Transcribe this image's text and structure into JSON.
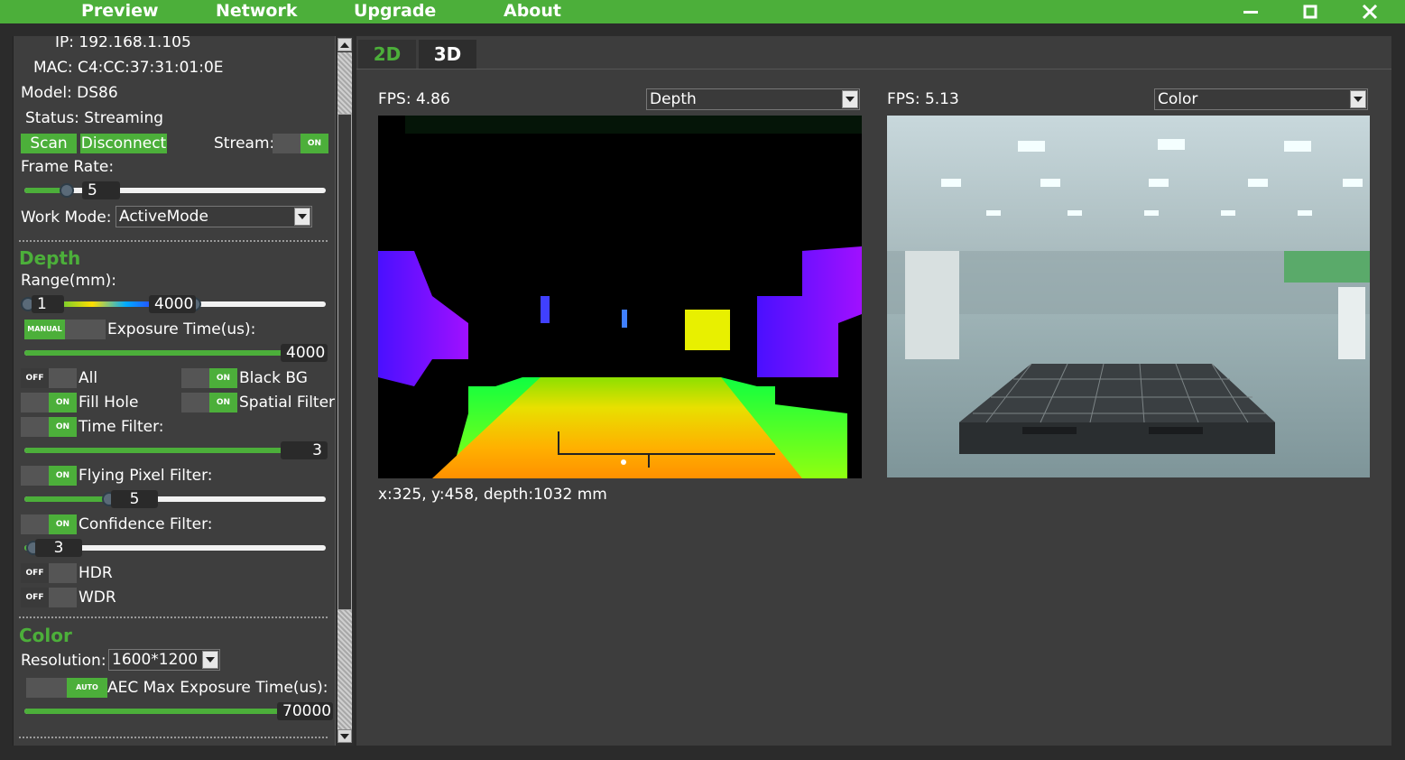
{
  "menu": {
    "preview": "Preview",
    "network": "Network",
    "upgrade": "Upgrade",
    "about": "About"
  },
  "window_controls": [
    "minimize-icon",
    "maximize-icon",
    "close-icon"
  ],
  "device": {
    "ip": "IP: 192.168.1.105",
    "mac": "MAC: C4:CC:37:31:01:0E",
    "model": "Model: DS86",
    "status": "Status: Streaming"
  },
  "buttons": {
    "scan": "Scan",
    "disconnect": "Disconnect"
  },
  "stream": {
    "label": "Stream:",
    "state": "ON"
  },
  "frame_rate": {
    "label": "Frame Rate:",
    "value": "5",
    "fraction": 0.14
  },
  "work_mode": {
    "label": "Work Mode:",
    "value": "ActiveMode"
  },
  "depth": {
    "title": "Depth",
    "range_label": "Range(mm):",
    "range_min": "1",
    "range_max": "4000",
    "exposure_mode": "MANUAL",
    "exposure_label": "Exposure Time(us):",
    "exposure_value": "4000",
    "exposure_fraction": 1.0,
    "toggles": {
      "all": {
        "state": "OFF",
        "label": "All"
      },
      "black_bg": {
        "state": "ON",
        "label": "Black BG"
      },
      "fill_hole": {
        "state": "ON",
        "label": "Fill Hole"
      },
      "spatial_filter": {
        "state": "ON",
        "label": "Spatial Filter"
      },
      "time_filter": {
        "state": "ON",
        "label": "Time Filter:"
      },
      "flying_pixel": {
        "state": "ON",
        "label": "Flying Pixel Filter:"
      },
      "confidence": {
        "state": "ON",
        "label": "Confidence Filter:"
      },
      "hdr": {
        "state": "OFF",
        "label": "HDR"
      },
      "wdr": {
        "state": "OFF",
        "label": "WDR"
      }
    },
    "time_filter_value": "3",
    "time_filter_fraction": 1.0,
    "flying_pixel_value": "5",
    "flying_pixel_fraction": 0.28,
    "confidence_value": "3",
    "confidence_fraction": 0.03
  },
  "color": {
    "title": "Color",
    "resolution_label": "Resolution:",
    "resolution_value": "1600*1200",
    "aec_mode": "AUTO",
    "aec_label": "AEC Max Exposure Time(us):",
    "aec_value": "70000",
    "aec_fraction": 1.0
  },
  "tabs": [
    "2D",
    "3D"
  ],
  "depth_view": {
    "fps": "FPS: 4.86",
    "mode": "Depth",
    "readout": "x:325, y:458, depth:1032 mm"
  },
  "color_view": {
    "fps": "FPS: 5.13",
    "mode": "Color"
  },
  "accent_color": "#4caf3a"
}
